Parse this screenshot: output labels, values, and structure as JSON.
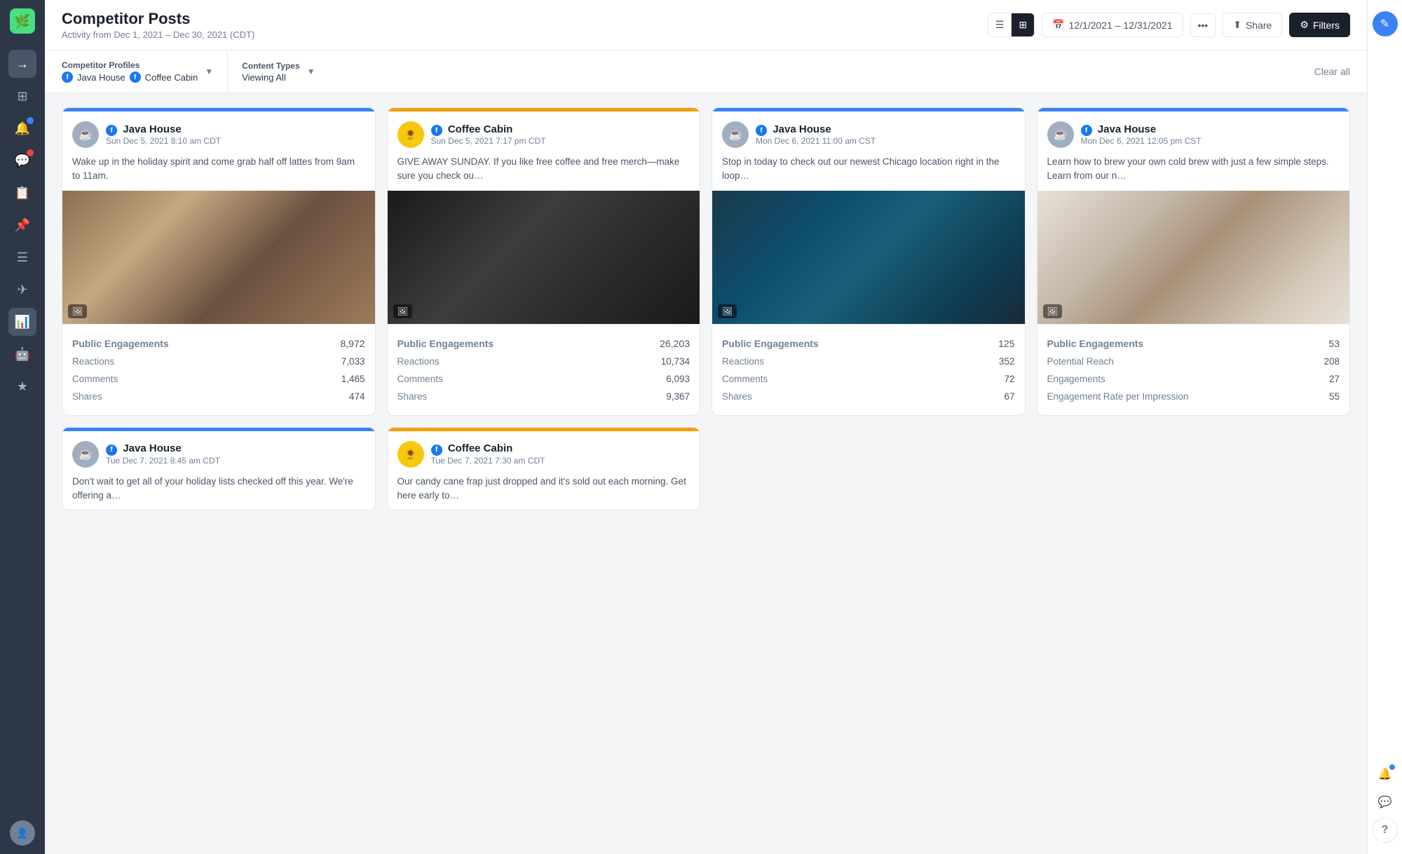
{
  "app": {
    "logo": "🌿",
    "title": "Competitor Posts",
    "subtitle": "Activity from Dec 1, 2021 – Dec 30, 2021 (CDT)"
  },
  "header": {
    "date_range": "12/1/2021 – 12/31/2021",
    "share_label": "Share",
    "filters_label": "Filters"
  },
  "filters": {
    "competitor_profiles_label": "Competitor Profiles",
    "competitor_profiles_value": "Java House  Coffee Cabin",
    "content_types_label": "Content Types",
    "content_types_value": "Viewing All",
    "clear_all_label": "Clear all"
  },
  "cards": [
    {
      "id": "card1",
      "brand": "Java House",
      "brand_key": "java_house",
      "date": "Sun Dec 5, 2021 8:10 am CDT",
      "text": "Wake up in the holiday spirit and come grab half off lattes from 9am to 11am.",
      "img_class": "img-coffee-pour",
      "accent": "#3b82f6",
      "stats": {
        "public_engagements": "8,972",
        "reactions": "7,033",
        "comments": "1,465",
        "shares": "474"
      }
    },
    {
      "id": "card2",
      "brand": "Coffee Cabin",
      "brand_key": "coffee_cabin",
      "date": "Sun Dec 5, 2021 7:17 pm CDT",
      "text": "GIVE AWAY SUNDAY. If you like free coffee and free merch—make sure you check ou…",
      "img_class": "img-merch",
      "accent": "#f59e0b",
      "stats": {
        "public_engagements": "26,203",
        "reactions": "10,734",
        "comments": "6,093",
        "shares": "9,367"
      }
    },
    {
      "id": "card3",
      "brand": "Java House",
      "brand_key": "java_house",
      "date": "Mon Dec 6, 2021 11:00 am CST",
      "text": "Stop in today to check out our newest Chicago location right in the loop…",
      "img_class": "img-coffee-sign",
      "accent": "#3b82f6",
      "stats": {
        "public_engagements": "125",
        "reactions": "352",
        "comments": "72",
        "shares": "67"
      }
    },
    {
      "id": "card4",
      "brand": "Java House",
      "brand_key": "java_house",
      "date": "Mon Dec 6, 2021 12:05 pm CST",
      "text": "Learn how to brew your own cold brew with just a few simple steps. Learn from our n…",
      "img_class": "img-cold-brew",
      "accent": "#3b82f6",
      "stats_alt": {
        "public_engagements": "53",
        "potential_reach": "208",
        "engagements": "27",
        "engagement_rate": "55"
      }
    },
    {
      "id": "card5",
      "brand": "Java House",
      "brand_key": "java_house",
      "date": "Tue Dec 7, 2021 8:45 am CDT",
      "text": "Don't wait to get all of your holiday lists checked off this year. We're offering a…",
      "img_class": "img-holiday",
      "accent": "#3b82f6",
      "partial": true
    },
    {
      "id": "card6",
      "brand": "Coffee Cabin",
      "brand_key": "coffee_cabin",
      "date": "Tue Dec 7, 2021 7:30 am CDT",
      "text": "Our candy cane frap just dropped and it's sold out each morning. Get here early to…",
      "img_class": "img-candy-cane",
      "accent": "#f59e0b",
      "partial": true
    }
  ],
  "stat_labels": {
    "public_engagements": "Public Engagements",
    "reactions": "Reactions",
    "comments": "Comments",
    "shares": "Shares",
    "potential_reach": "Potential Reach",
    "engagements": "Engagements",
    "engagement_rate": "Engagement Rate per Impression"
  },
  "sidebar": {
    "icons": [
      {
        "name": "arrow-right-icon",
        "glyph": "→"
      },
      {
        "name": "layers-icon",
        "glyph": "⊞"
      },
      {
        "name": "bell-icon",
        "glyph": "🔔",
        "badge": true,
        "badge_color": "blue"
      },
      {
        "name": "chat-icon",
        "glyph": "💬",
        "badge": true,
        "badge_color": "red"
      },
      {
        "name": "calendar-icon",
        "glyph": "📋"
      },
      {
        "name": "pin-icon",
        "glyph": "📌"
      },
      {
        "name": "list-icon",
        "glyph": "☰"
      },
      {
        "name": "send-icon",
        "glyph": "✈"
      },
      {
        "name": "chart-icon",
        "glyph": "📊",
        "active": true
      },
      {
        "name": "robot-icon",
        "glyph": "🤖"
      },
      {
        "name": "star-icon",
        "glyph": "★"
      }
    ]
  },
  "right_sidebar": {
    "icons": [
      {
        "name": "edit-icon",
        "glyph": "✎",
        "color": "#3b82f6"
      },
      {
        "name": "notification-icon",
        "glyph": "🔔",
        "badge": true
      },
      {
        "name": "comment-icon",
        "glyph": "💬"
      },
      {
        "name": "help-icon",
        "glyph": "?"
      }
    ]
  }
}
